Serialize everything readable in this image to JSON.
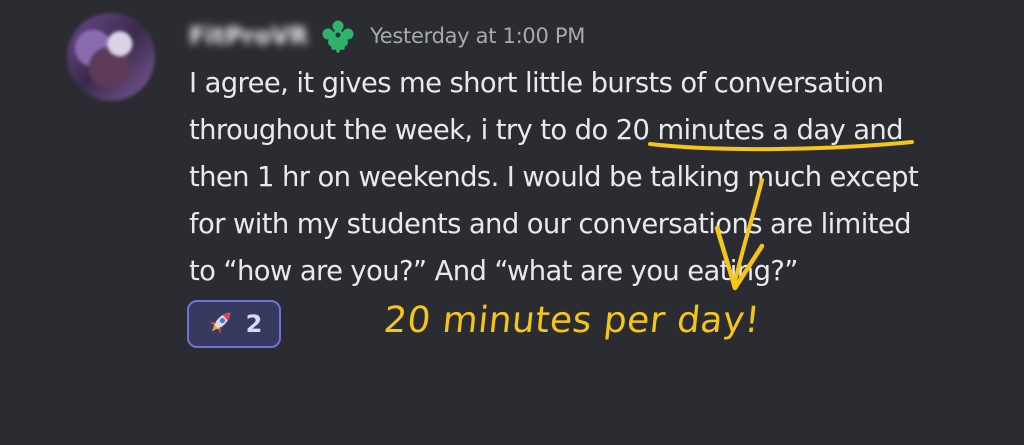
{
  "message": {
    "author_name": "FitProVR",
    "timestamp": "Yesterday at 1:00 PM",
    "badge_icon": "green-leaf-badge-icon",
    "lines": [
      "I agree, it gives me short little bursts of conversation",
      "throughout the week, i try to do 20 minutes a day and",
      "then 1 hr on weekends. I would be talking much except",
      "for with my students and our conversations are limited",
      "to “how are you?” And “what are you eating?”"
    ]
  },
  "reaction": {
    "emoji": "🚀",
    "count": "2"
  },
  "annotation": {
    "text": "20 minutes per day!",
    "color": "#f5c518"
  },
  "colors": {
    "background": "#2b2c31",
    "text": "#e8e9ec",
    "timestamp": "#a7a9b0",
    "reaction_border": "#6f73d6",
    "badge": "#2fb36b"
  }
}
